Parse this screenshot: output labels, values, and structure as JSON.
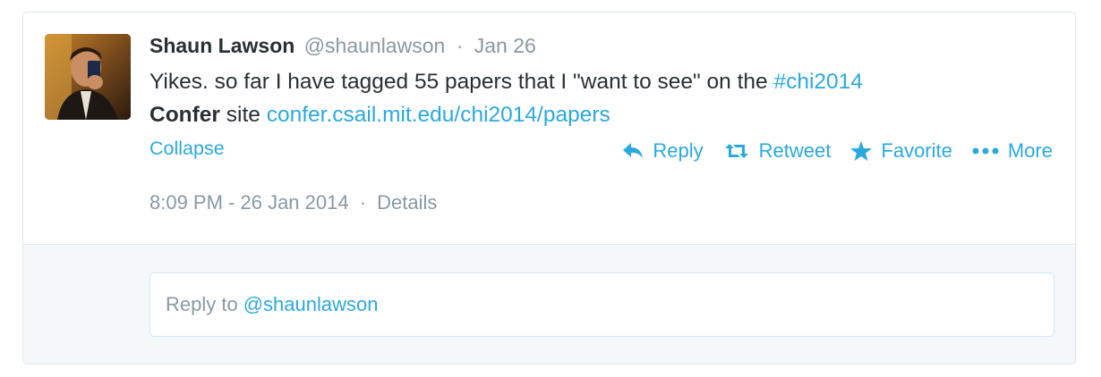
{
  "tweet": {
    "fullname": "Shaun Lawson",
    "screenname": "@shaunlawson",
    "separator": "·",
    "date": "Jan 26",
    "text_part1": "Yikes. so far I have tagged 55 papers that I \"want to see\" on the ",
    "hashtag": "#chi2014",
    "text_bold": "Confer",
    "text_part2": " site ",
    "link": "confer.csail.mit.edu/chi2014/papers"
  },
  "collapse_label": "Collapse",
  "actions": {
    "reply": {
      "label": "Reply",
      "icon": "reply-icon"
    },
    "retweet": {
      "label": "Retweet",
      "icon": "retweet-icon"
    },
    "favorite": {
      "label": "Favorite",
      "icon": "star-icon"
    },
    "more": {
      "label": "More",
      "icon": "more-dots-icon"
    }
  },
  "meta": {
    "timestamp": "8:09 PM - 26 Jan 2014",
    "separator": "·",
    "details": "Details"
  },
  "reply_box": {
    "prefix": "Reply to",
    "mention": "@shaunlawson"
  },
  "colors": {
    "link": "#2aa9e0",
    "text": "#292f33",
    "muted": "#8899a6",
    "border": "#e1e8ed",
    "reply_bg": "#f5f8fa"
  }
}
